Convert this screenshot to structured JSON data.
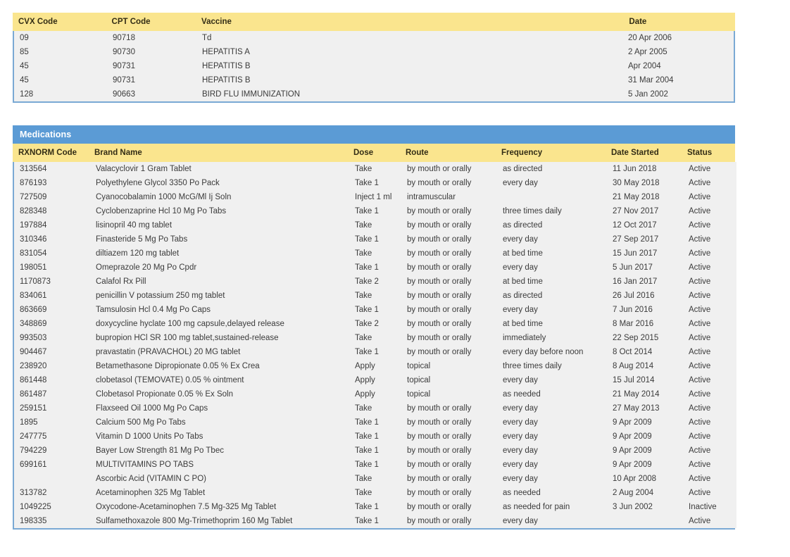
{
  "colors": {
    "section_header_bg": "#5b9bd5",
    "table_header_bg": "#fae58e",
    "table_body_bg": "#f0f0f0",
    "border": "#7aa9d4",
    "text": "#3b3b3b",
    "header_text": "#332d15",
    "section_header_text": "#ffffff"
  },
  "immunizations": {
    "columns": [
      "CVX Code",
      "CPT Code",
      "Vaccine",
      "Date"
    ],
    "rows": [
      {
        "cvx_code": "09",
        "cpt_code": "90718",
        "vaccine": "Td",
        "date": "20 Apr 2006"
      },
      {
        "cvx_code": "85",
        "cpt_code": "90730",
        "vaccine": "HEPATITIS A",
        "date": "2 Apr 2005"
      },
      {
        "cvx_code": "45",
        "cpt_code": "90731",
        "vaccine": "HEPATITIS B",
        "date": "Apr 2004"
      },
      {
        "cvx_code": "45",
        "cpt_code": "90731",
        "vaccine": "HEPATITIS B",
        "date": "31 Mar 2004"
      },
      {
        "cvx_code": "128",
        "cpt_code": "90663",
        "vaccine": "BIRD FLU IMMUNIZATION",
        "date": "5 Jan 2002"
      }
    ]
  },
  "medications": {
    "section_title": "Medications",
    "columns": [
      "RXNORM Code",
      "Brand Name",
      "Dose",
      "Route",
      "Frequency",
      "Date Started",
      "Status"
    ],
    "rows": [
      {
        "rxnorm_code": "313564",
        "brand_name": "Valacyclovir 1 Gram Tablet",
        "dose": "Take",
        "route": "by mouth or orally",
        "frequency": "as directed",
        "date_started": "11 Jun 2018",
        "status": "Active"
      },
      {
        "rxnorm_code": "876193",
        "brand_name": "Polyethylene Glycol 3350 Po Pack",
        "dose": "Take 1",
        "route": "by mouth or orally",
        "frequency": "every day",
        "date_started": "30 May 2018",
        "status": "Active"
      },
      {
        "rxnorm_code": "727509",
        "brand_name": "Cyanocobalamin 1000 McG/Ml Ij Soln",
        "dose": "Inject 1 ml",
        "route": "intramuscular",
        "frequency": "",
        "date_started": "21 May 2018",
        "status": "Active"
      },
      {
        "rxnorm_code": "828348",
        "brand_name": "Cyclobenzaprine Hcl 10 Mg Po Tabs",
        "dose": "Take 1",
        "route": "by mouth or orally",
        "frequency": "three times daily",
        "date_started": "27 Nov 2017",
        "status": "Active"
      },
      {
        "rxnorm_code": "197884",
        "brand_name": "lisinopril 40 mg tablet",
        "dose": "Take",
        "route": "by mouth or orally",
        "frequency": "as directed",
        "date_started": "12 Oct 2017",
        "status": "Active"
      },
      {
        "rxnorm_code": "310346",
        "brand_name": "Finasteride 5 Mg Po Tabs",
        "dose": "Take 1",
        "route": "by mouth or orally",
        "frequency": "every day",
        "date_started": "27 Sep 2017",
        "status": "Active"
      },
      {
        "rxnorm_code": "831054",
        "brand_name": "diltiazem 120 mg tablet",
        "dose": "Take",
        "route": "by mouth or orally",
        "frequency": "at bed time",
        "date_started": "15 Jun 2017",
        "status": "Active"
      },
      {
        "rxnorm_code": "198051",
        "brand_name": "Omeprazole 20 Mg Po Cpdr",
        "dose": "Take 1",
        "route": "by mouth or orally",
        "frequency": "every day",
        "date_started": "5 Jun 2017",
        "status": "Active"
      },
      {
        "rxnorm_code": "1170873",
        "brand_name": "Calafol Rx Pill",
        "dose": "Take 2",
        "route": "by mouth or orally",
        "frequency": "at bed time",
        "date_started": "16 Jan 2017",
        "status": "Active"
      },
      {
        "rxnorm_code": "834061",
        "brand_name": "penicillin V potassium 250 mg tablet",
        "dose": "Take",
        "route": "by mouth or orally",
        "frequency": "as directed",
        "date_started": "26 Jul 2016",
        "status": "Active"
      },
      {
        "rxnorm_code": "863669",
        "brand_name": "Tamsulosin Hcl 0.4 Mg Po Caps",
        "dose": "Take 1",
        "route": "by mouth or orally",
        "frequency": "every day",
        "date_started": "7 Jun 2016",
        "status": "Active"
      },
      {
        "rxnorm_code": "348869",
        "brand_name": "doxycycline hyclate 100 mg capsule,delayed release",
        "dose": "Take 2",
        "route": "by mouth or orally",
        "frequency": "at bed time",
        "date_started": "8 Mar 2016",
        "status": "Active"
      },
      {
        "rxnorm_code": "993503",
        "brand_name": "bupropion HCl SR 100 mg tablet,sustained-release",
        "dose": "Take",
        "route": "by mouth or orally",
        "frequency": "immediately",
        "date_started": "22 Sep 2015",
        "status": "Active"
      },
      {
        "rxnorm_code": "904467",
        "brand_name": "pravastatin (PRAVACHOL) 20 MG tablet",
        "dose": "Take 1",
        "route": "by mouth or orally",
        "frequency": "every day before noon",
        "date_started": "8 Oct 2014",
        "status": "Active"
      },
      {
        "rxnorm_code": "238920",
        "brand_name": "Betamethasone Dipropionate 0.05 % Ex Crea",
        "dose": "Apply",
        "route": "topical",
        "frequency": "three times daily",
        "date_started": "8 Aug 2014",
        "status": "Active"
      },
      {
        "rxnorm_code": "861448",
        "brand_name": "clobetasol (TEMOVATE) 0.05 % ointment",
        "dose": "Apply",
        "route": "topical",
        "frequency": "every day",
        "date_started": "15 Jul 2014",
        "status": "Active"
      },
      {
        "rxnorm_code": "861487",
        "brand_name": "Clobetasol Propionate 0.05 % Ex Soln",
        "dose": "Apply",
        "route": "topical",
        "frequency": "as needed",
        "date_started": "21 May 2014",
        "status": "Active"
      },
      {
        "rxnorm_code": "259151",
        "brand_name": "Flaxseed Oil 1000 Mg Po Caps",
        "dose": "Take",
        "route": "by mouth or orally",
        "frequency": "every day",
        "date_started": "27 May 2013",
        "status": "Active"
      },
      {
        "rxnorm_code": "1895",
        "brand_name": "Calcium 500 Mg Po Tabs",
        "dose": "Take 1",
        "route": "by mouth or orally",
        "frequency": "every day",
        "date_started": "9 Apr 2009",
        "status": "Active"
      },
      {
        "rxnorm_code": "247775",
        "brand_name": "Vitamin D 1000 Units Po Tabs",
        "dose": "Take 1",
        "route": "by mouth or orally",
        "frequency": "every day",
        "date_started": "9 Apr 2009",
        "status": "Active"
      },
      {
        "rxnorm_code": "794229",
        "brand_name": "Bayer Low Strength 81 Mg Po Tbec",
        "dose": "Take 1",
        "route": "by mouth or orally",
        "frequency": "every day",
        "date_started": "9 Apr 2009",
        "status": "Active"
      },
      {
        "rxnorm_code": "699161",
        "brand_name": "MULTIVITAMINS PO TABS",
        "dose": "Take 1",
        "route": "by mouth or orally",
        "frequency": "every day",
        "date_started": "9 Apr 2009",
        "status": "Active"
      },
      {
        "rxnorm_code": "",
        "brand_name": "Ascorbic Acid (VITAMIN C PO)",
        "dose": "Take",
        "route": "by mouth or orally",
        "frequency": "every day",
        "date_started": "10 Apr 2008",
        "status": "Active"
      },
      {
        "rxnorm_code": "313782",
        "brand_name": "Acetaminophen 325 Mg Tablet",
        "dose": "Take",
        "route": "by mouth or orally",
        "frequency": "as needed",
        "date_started": "2 Aug 2004",
        "status": "Active"
      },
      {
        "rxnorm_code": "1049225",
        "brand_name": "Oxycodone-Acetaminophen 7.5 Mg-325 Mg Tablet",
        "dose": "Take 1",
        "route": "by mouth or orally",
        "frequency": "as needed for pain",
        "date_started": "3 Jun 2002",
        "status": "Inactive"
      },
      {
        "rxnorm_code": "198335",
        "brand_name": "Sulfamethoxazole 800 Mg-Trimethoprim 160 Mg Tablet",
        "dose": "Take 1",
        "route": "by mouth or orally",
        "frequency": "every day",
        "date_started": "",
        "status": "Active"
      }
    ]
  }
}
